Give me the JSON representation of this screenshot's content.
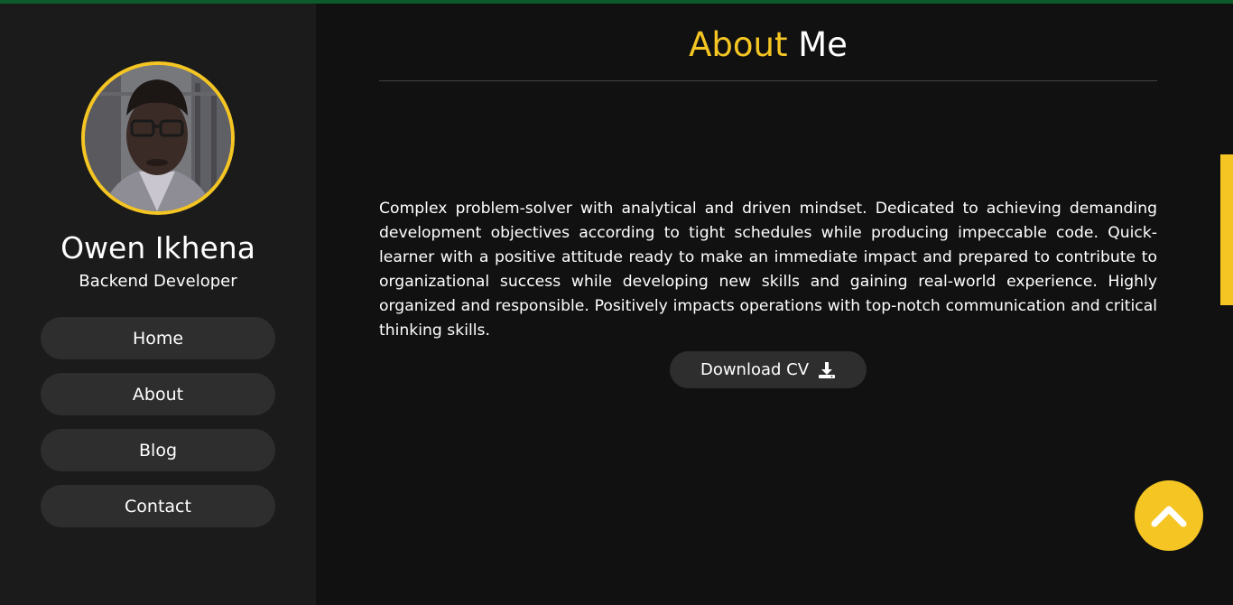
{
  "profile": {
    "name": "Owen Ikhena",
    "role": "Backend Developer"
  },
  "nav": {
    "items": [
      {
        "label": "Home"
      },
      {
        "label": "About"
      },
      {
        "label": "Blog"
      },
      {
        "label": "Contact"
      }
    ]
  },
  "about": {
    "title_accent": "About",
    "title_rest": "Me",
    "bio": "Complex problem-solver with analytical and driven mindset. Dedicated to achieving demanding development objectives according to tight schedules while producing impeccable code. Quick-learner with a positive attitude ready to make an immediate impact and prepared to contribute to organizational success while developing new skills and gaining real-world experience. Highly organized and responsible. Positively impacts operations with top-notch communication and critical thinking skills.",
    "download_label": "Download CV"
  },
  "icons": {
    "download": "download-icon",
    "back_to_top": "chevron-up-icon"
  },
  "colors": {
    "accent": "#f5c623",
    "top_bar": "#0d5b2a",
    "sidebar_bg": "#1b1b1b",
    "main_bg": "#111111",
    "button_bg": "#2e2e2e"
  }
}
